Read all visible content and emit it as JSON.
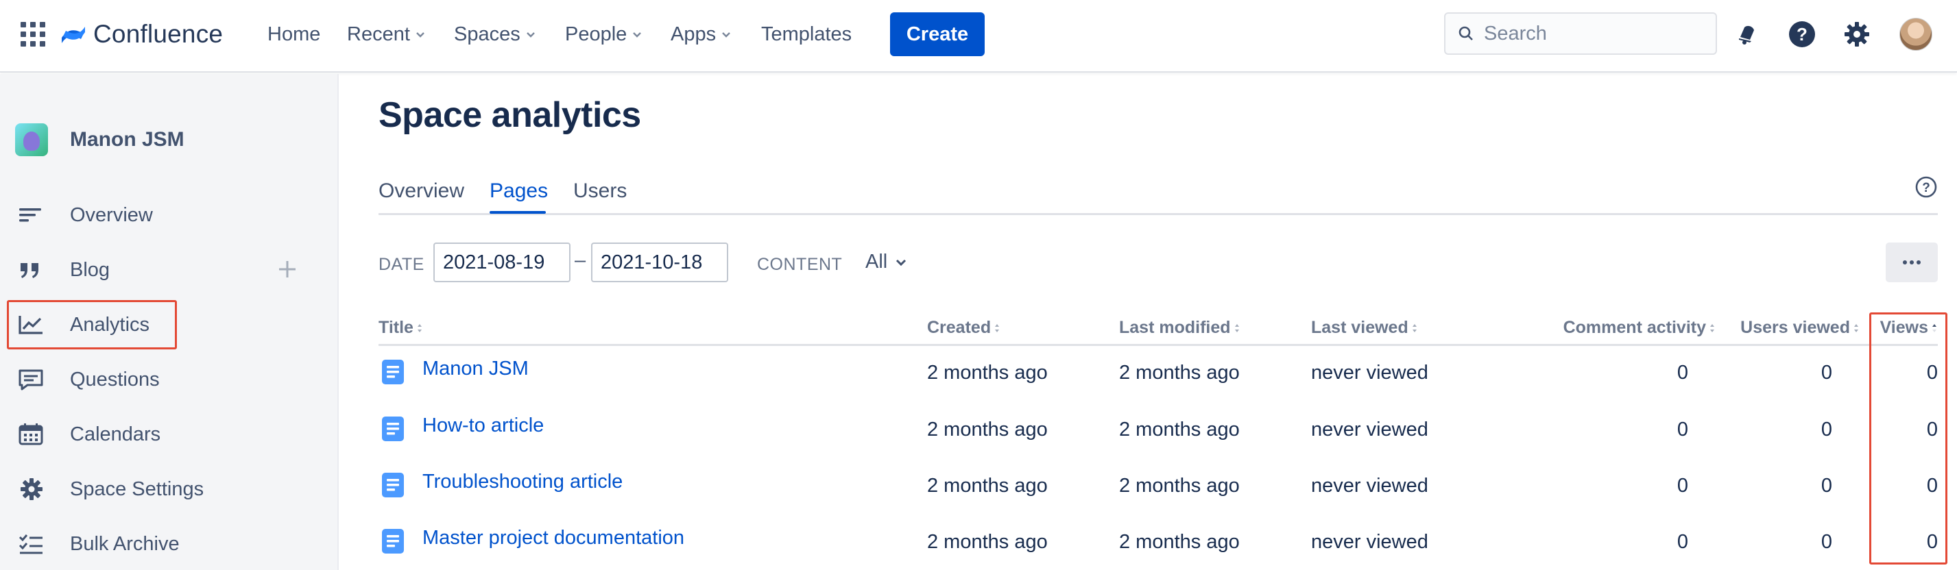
{
  "topnav": {
    "brand": "Confluence",
    "items": [
      {
        "label": "Home",
        "dropdown": false
      },
      {
        "label": "Recent",
        "dropdown": true
      },
      {
        "label": "Spaces",
        "dropdown": true
      },
      {
        "label": "People",
        "dropdown": true
      },
      {
        "label": "Apps",
        "dropdown": true
      },
      {
        "label": "Templates",
        "dropdown": false
      }
    ],
    "create_label": "Create",
    "search_placeholder": "Search"
  },
  "sidebar": {
    "space_name": "Manon JSM",
    "items": [
      {
        "label": "Overview",
        "icon": "overview-icon"
      },
      {
        "label": "Blog",
        "icon": "quote-icon"
      },
      {
        "label": "Analytics",
        "icon": "analytics-icon"
      },
      {
        "label": "Questions",
        "icon": "questions-icon"
      },
      {
        "label": "Calendars",
        "icon": "calendar-icon"
      },
      {
        "label": "Space Settings",
        "icon": "gear-icon"
      },
      {
        "label": "Bulk Archive",
        "icon": "bulk-archive-icon"
      }
    ]
  },
  "main": {
    "title": "Space analytics",
    "tabs": [
      {
        "label": "Overview",
        "active": false
      },
      {
        "label": "Pages",
        "active": true
      },
      {
        "label": "Users",
        "active": false
      }
    ],
    "filters": {
      "date_label": "DATE",
      "date_from": "2021-08-19",
      "date_to": "2021-10-18",
      "date_separator": "–",
      "content_label": "CONTENT",
      "content_value": "All"
    },
    "table": {
      "columns": [
        "Title",
        "Created",
        "Last modified",
        "Last viewed",
        "Comment activity",
        "Users viewed",
        "Views"
      ],
      "rows": [
        {
          "title": "Manon JSM",
          "created": "2 months ago",
          "modified": "2 months ago",
          "viewed": "never viewed",
          "comments": "0",
          "users": "0",
          "views": "0"
        },
        {
          "title": "How-to article",
          "created": "2 months ago",
          "modified": "2 months ago",
          "viewed": "never viewed",
          "comments": "0",
          "users": "0",
          "views": "0"
        },
        {
          "title": "Troubleshooting article",
          "created": "2 months ago",
          "modified": "2 months ago",
          "viewed": "never viewed",
          "comments": "0",
          "users": "0",
          "views": "0"
        },
        {
          "title": "Master project documentation",
          "created": "2 months ago",
          "modified": "2 months ago",
          "viewed": "never viewed",
          "comments": "0",
          "users": "0",
          "views": "0"
        }
      ]
    }
  },
  "colors": {
    "accent": "#0052CC",
    "highlight": "#E34935",
    "text": "#172B4D",
    "muted": "#6B778C"
  }
}
